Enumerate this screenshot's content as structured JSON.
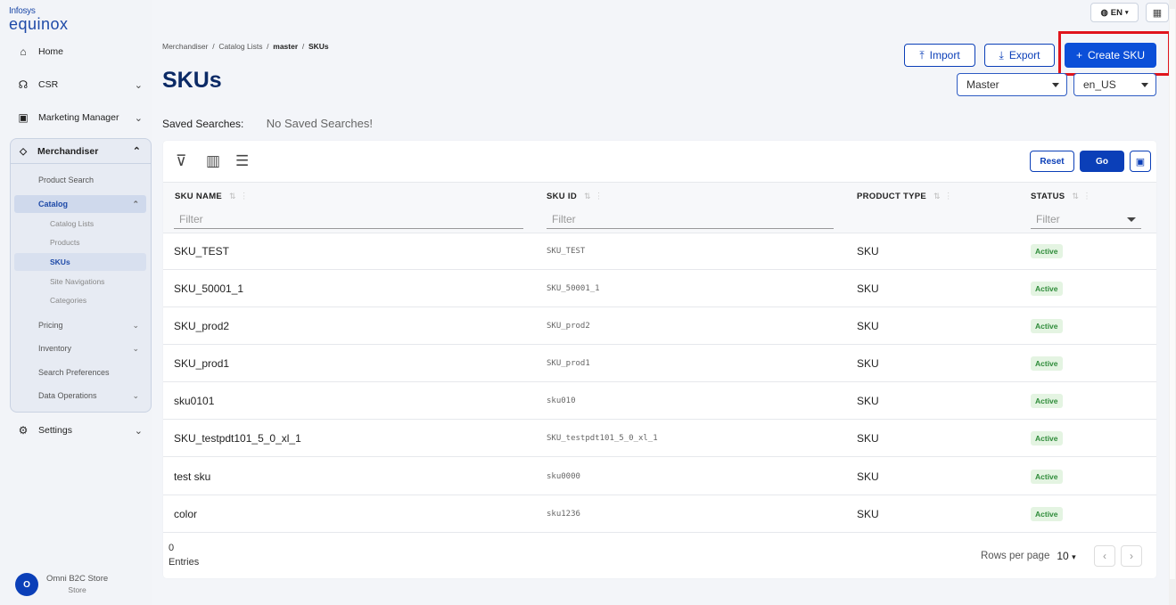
{
  "logo": {
    "line1": "Infosys",
    "line2": "equinox"
  },
  "sidebar": {
    "home": "Home",
    "csr": "CSR",
    "marketing": "Marketing Manager",
    "merchandiser": "Merchandiser",
    "product_search": "Product Search",
    "catalog": "Catalog",
    "catalog_lists": "Catalog Lists",
    "products": "Products",
    "skus": "SKUs",
    "site_navigations": "Site Navigations",
    "categories": "Categories",
    "pricing": "Pricing",
    "inventory": "Inventory",
    "search_preferences": "Search Preferences",
    "data_operations": "Data Operations",
    "settings": "Settings",
    "store_initial": "O",
    "store_name": "Omni B2C Store",
    "store_type": "Store"
  },
  "header": {
    "lang": "EN",
    "breadcrumb": [
      "Merchandiser",
      "Catalog Lists",
      "master",
      "SKUs"
    ],
    "title": "SKUs",
    "import_label": "Import",
    "export_label": "Export",
    "create_label": "Create SKU",
    "catalog_select": "Master",
    "locale_select": "en_US",
    "saved_searches_label": "Saved Searches:",
    "saved_searches_value": "No Saved Searches!"
  },
  "toolbar": {
    "reset": "Reset",
    "go": "Go"
  },
  "table": {
    "columns": [
      "SKU NAME",
      "SKU ID",
      "PRODUCT TYPE",
      "STATUS"
    ],
    "filter_placeholder": "Filter",
    "rows": [
      {
        "name": "SKU_TEST",
        "id": "SKU_TEST",
        "type": "SKU",
        "status": "Active"
      },
      {
        "name": "SKU_50001_1",
        "id": "SKU_50001_1",
        "type": "SKU",
        "status": "Active"
      },
      {
        "name": "SKU_prod2",
        "id": "SKU_prod2",
        "type": "SKU",
        "status": "Active"
      },
      {
        "name": "SKU_prod1",
        "id": "SKU_prod1",
        "type": "SKU",
        "status": "Active"
      },
      {
        "name": "sku0101",
        "id": "sku010",
        "type": "SKU",
        "status": "Active"
      },
      {
        "name": "SKU_testpdt101_5_0_xl_1",
        "id": "SKU_testpdt101_5_0_xl_1",
        "type": "SKU",
        "status": "Active"
      },
      {
        "name": "test sku",
        "id": "sku0000",
        "type": "SKU",
        "status": "Active"
      },
      {
        "name": "color",
        "id": "sku1236",
        "type": "SKU",
        "status": "Active"
      }
    ]
  },
  "footer": {
    "count": "0",
    "entries": "Entries",
    "rows_per_page_label": "Rows per page",
    "rows_per_page_value": "10"
  },
  "colors": {
    "primary": "#0b4fd8",
    "highlight": "#e0141c",
    "active_badge": "#2e8b39"
  }
}
